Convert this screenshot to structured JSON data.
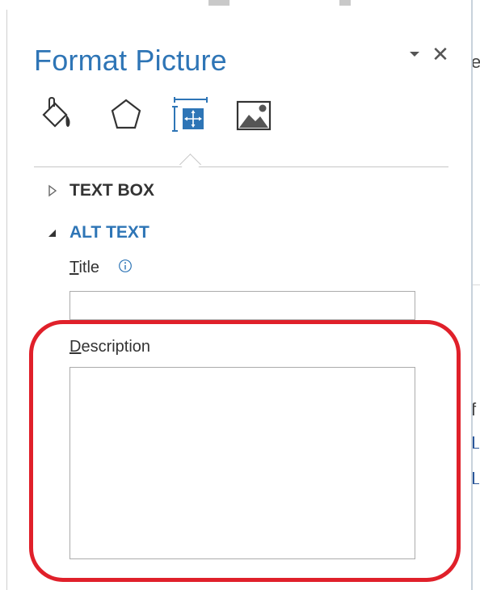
{
  "pane": {
    "title": "Format Picture",
    "dropdown_icon": "triangle-down-icon",
    "close_icon": "close-icon",
    "close_glyph": "✕"
  },
  "tabs": [
    {
      "name": "fill-line",
      "icon": "paint-bucket-icon",
      "selected": false
    },
    {
      "name": "effects",
      "icon": "pentagon-icon",
      "selected": false
    },
    {
      "name": "size-properties",
      "icon": "size-properties-icon",
      "selected": true
    },
    {
      "name": "picture",
      "icon": "picture-icon",
      "selected": false
    }
  ],
  "sections": {
    "text_box": {
      "label": "TEXT BOX",
      "expanded": false
    },
    "alt_text": {
      "label": "ALT TEXT",
      "expanded": true
    }
  },
  "alt_text": {
    "title_label_accel": "T",
    "title_label_rest": "itle",
    "title_value": "",
    "description_label_accel": "D",
    "description_label_rest": "escription",
    "description_value": ""
  },
  "colors": {
    "accent": "#2e75b6",
    "highlight": "#e0202a",
    "section_text": "#333333"
  }
}
